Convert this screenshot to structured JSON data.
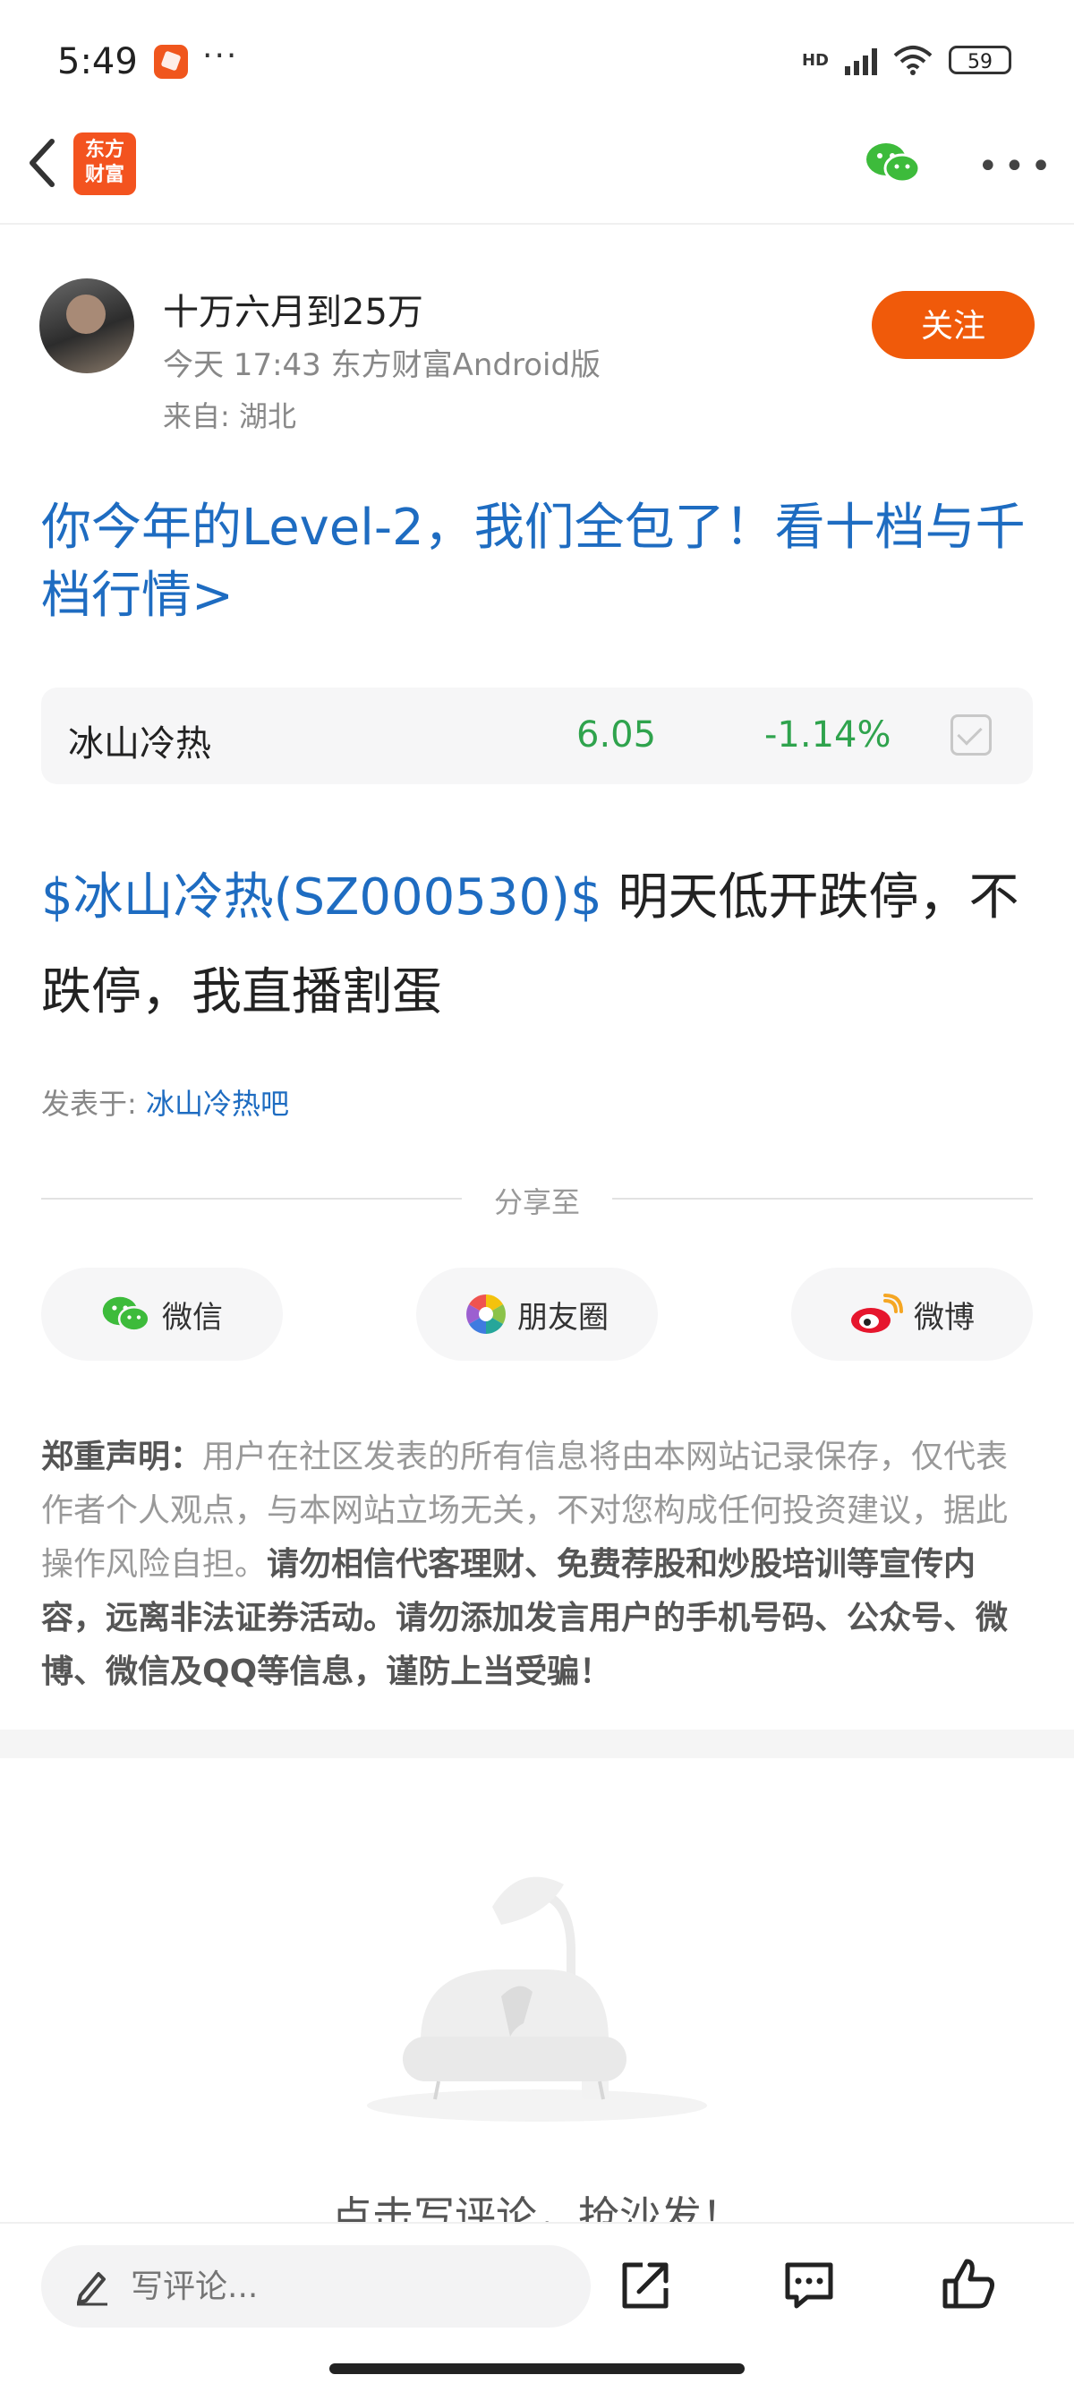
{
  "status_bar": {
    "time": "5:49",
    "more": "···",
    "network": "HD",
    "battery": "59"
  },
  "nav": {
    "logo_line1": "东方",
    "logo_line2": "财富"
  },
  "author": {
    "name": "十万六月到25万",
    "meta": "今天 17:43 东方财富Android版",
    "location": "来自: 湖北",
    "follow_label": "关注"
  },
  "promo": {
    "text": "你今年的Level-2，我们全包了！看十档与千档行情>"
  },
  "stock": {
    "name": "冰山冷热",
    "price": "6.05",
    "change": "-1.14%",
    "accent": "#2fa34d"
  },
  "post": {
    "tag": "$冰山冷热(SZ000530)$",
    "text": " 明天低开跌停，不跌停，我直播割蛋"
  },
  "posted_in": {
    "label": "发表于: ",
    "forum": "冰山冷热吧"
  },
  "share": {
    "label": "分享至",
    "wechat": "微信",
    "moments": "朋友圈",
    "weibo": "微博"
  },
  "disclaimer": {
    "title": "郑重声明：",
    "normal": "用户在社区发表的所有信息将由本网站记录保存，仅代表作者个人观点，与本网站立场无关，不对您构成任何投资建议，据此操作风险自担。",
    "bold": "请勿相信代客理财、免费荐股和炒股培训等宣传内容，远离非法证券活动。请勿添加发言用户的手机号码、公众号、微博、微信及QQ等信息，谨防上当受骗！"
  },
  "empty": {
    "text": "点击写评论，抢沙发！"
  },
  "bottom_bar": {
    "comment_placeholder": "写评论..."
  },
  "colors": {
    "brand": "#f05a0a",
    "link": "#1e6cc1",
    "down": "#2fa34d"
  }
}
